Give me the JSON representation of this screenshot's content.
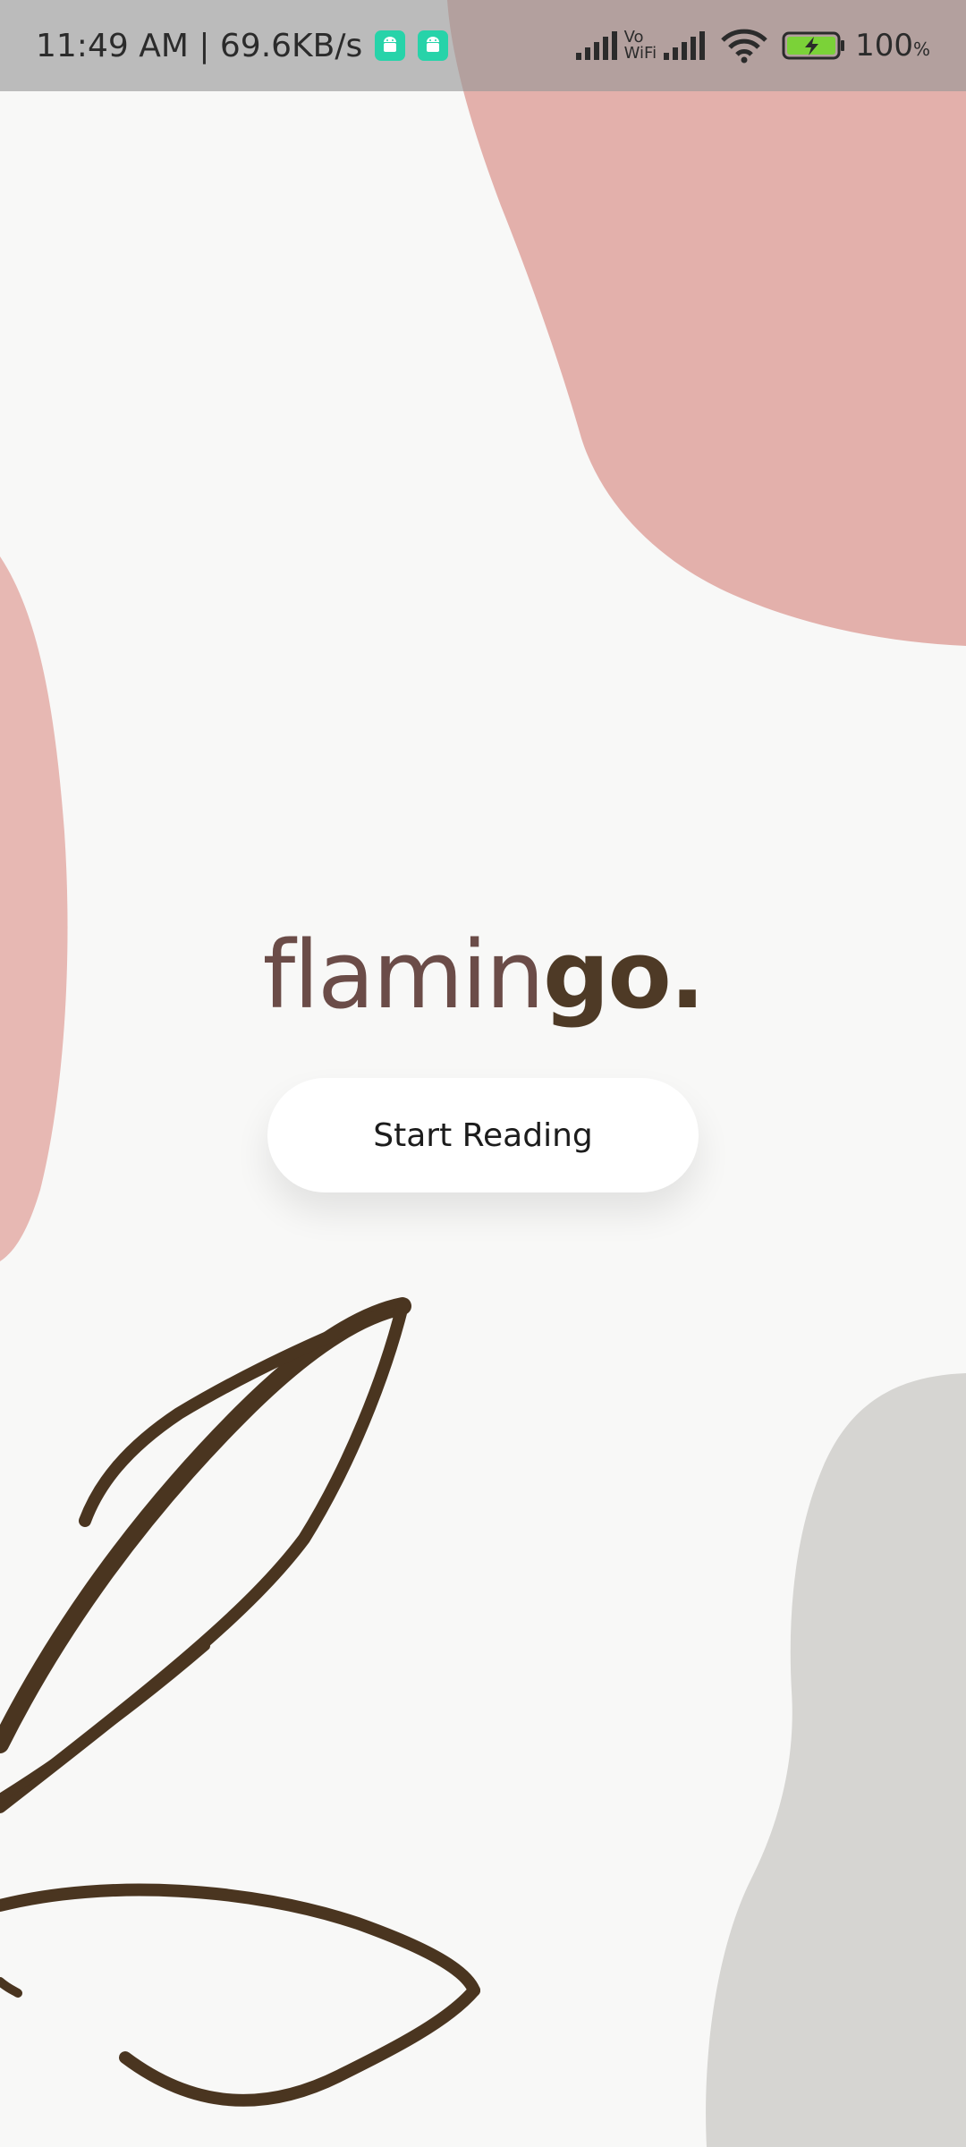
{
  "status_bar": {
    "time_speed": "11:49 AM | 69.6KB/s",
    "vowifi_top": "Vo",
    "vowifi_bottom": "WiFi",
    "battery_percent": "100",
    "battery_symbol": "%"
  },
  "icons": {
    "notification_1": "android-icon",
    "notification_2": "android-icon",
    "signal_1": "cell-signal-icon",
    "signal_2": "cell-signal-icon",
    "wifi": "wifi-icon",
    "battery": "battery-charging-icon"
  },
  "logo": {
    "light": "flamin",
    "bold": "go."
  },
  "start_button_label": "Start Reading",
  "colors": {
    "background": "#f8f8f7",
    "pink_blob": "#e3b0ab",
    "grey_blob": "#d6d5d2",
    "leaf": "#4a3520",
    "logo_light": "#6b4c48",
    "logo_bold": "#4e3a26",
    "android_badge": "#27d3a9",
    "battery_fill": "#7bd238"
  }
}
